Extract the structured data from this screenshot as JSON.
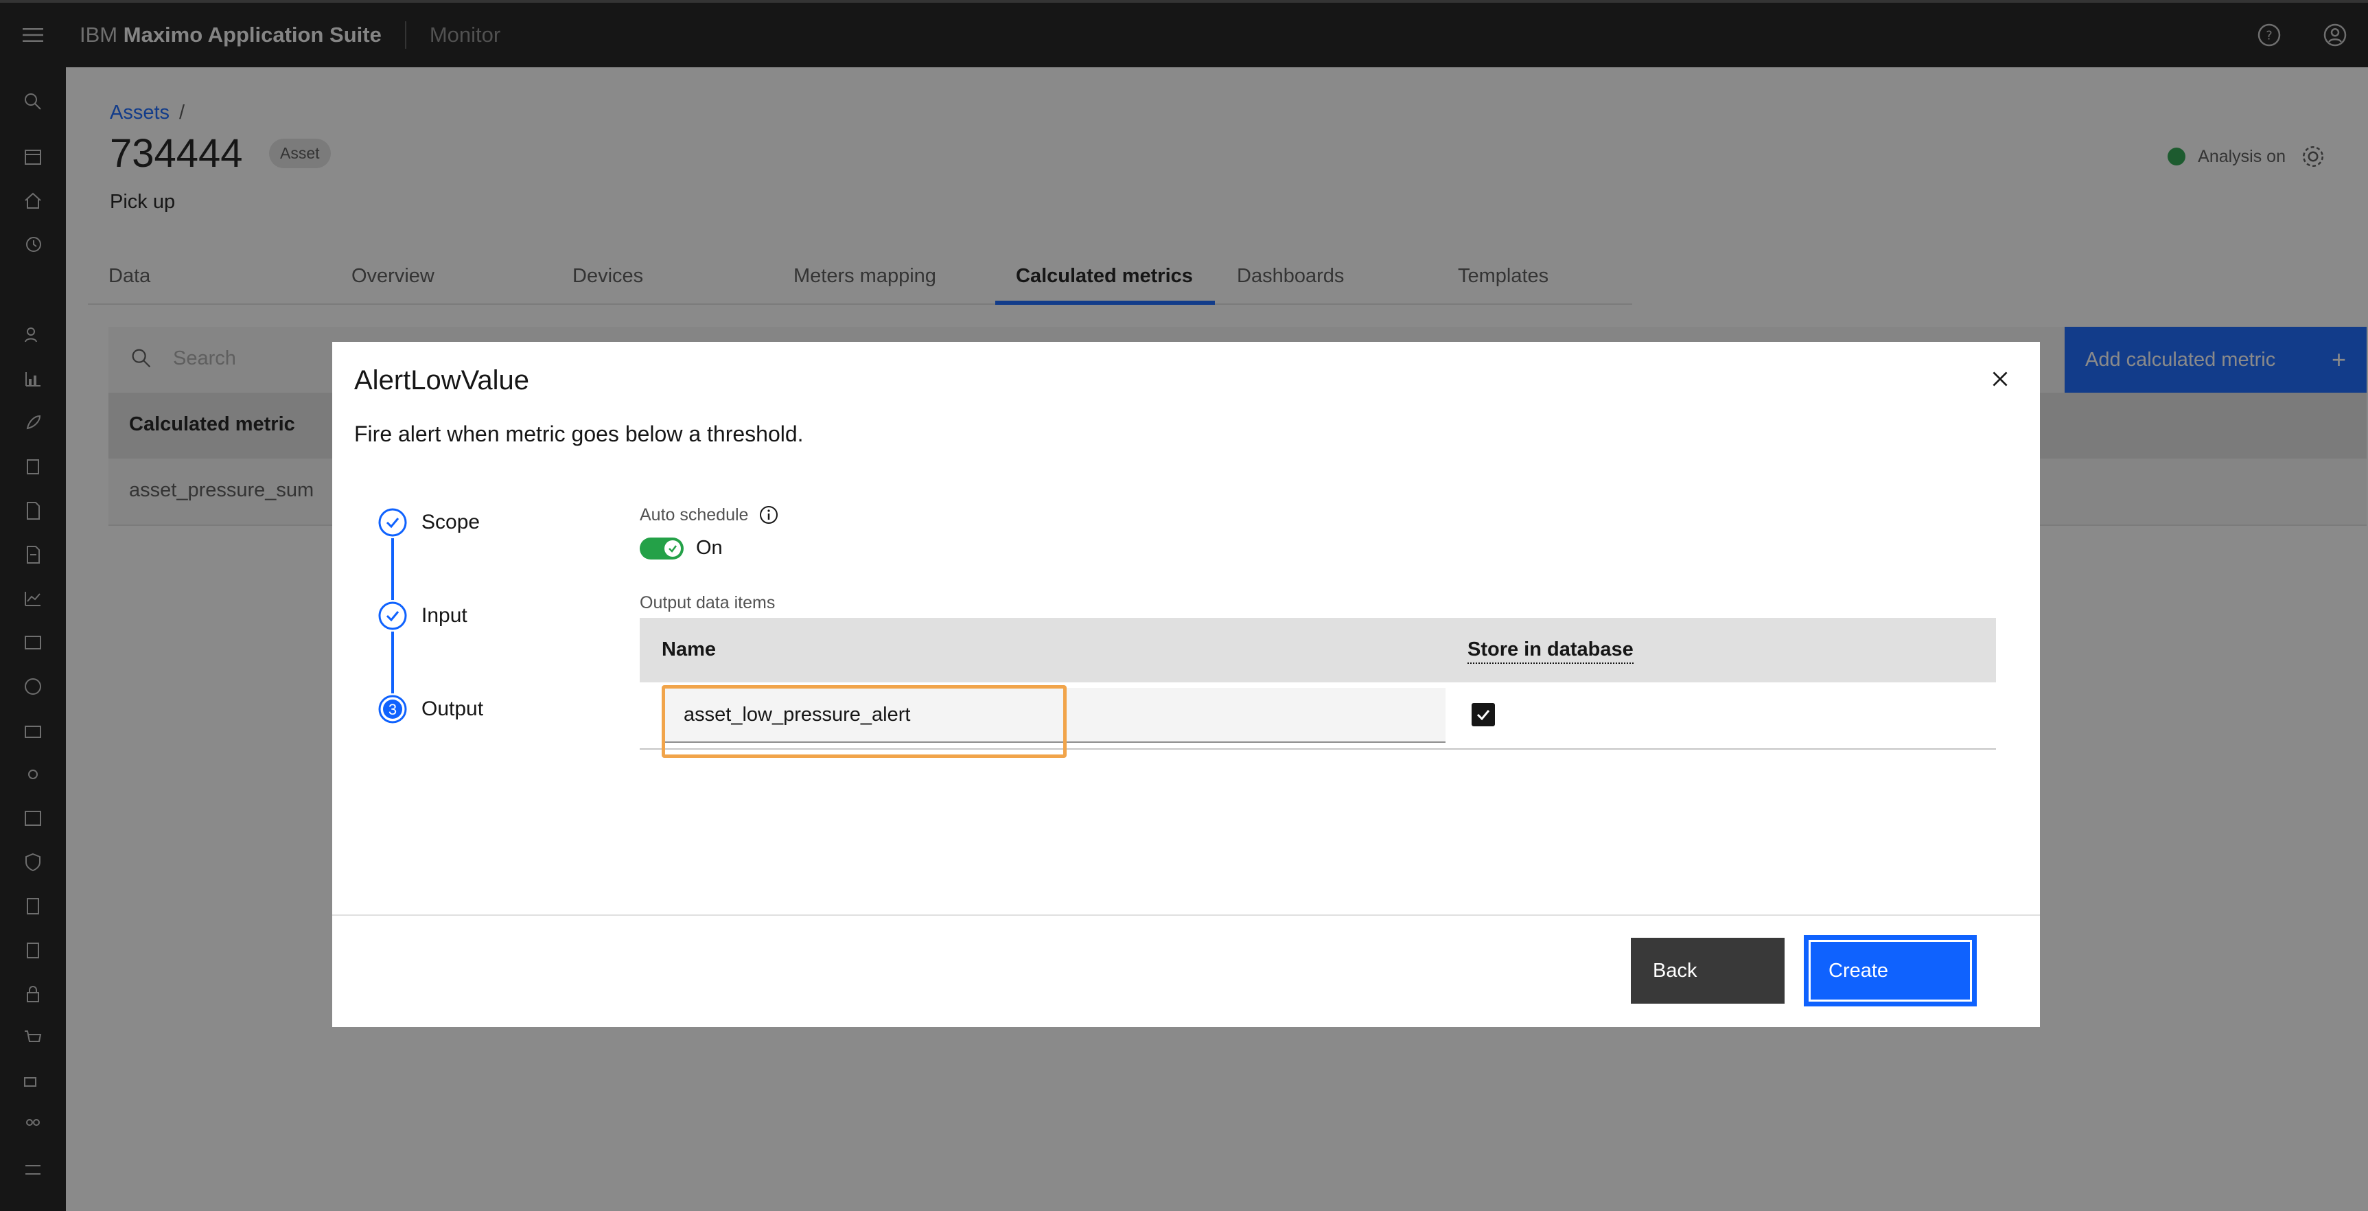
{
  "header": {
    "brand_prefix": "IBM",
    "brand_name": "Maximo Application Suite",
    "product": "Monitor"
  },
  "page": {
    "breadcrumb": "Assets",
    "breadcrumb_sep": "/",
    "asset_id": "734444",
    "asset_tag": "Asset",
    "asset_description": "Pick up",
    "analysis_status": "Analysis on"
  },
  "tabs": [
    {
      "label": "Data"
    },
    {
      "label": "Overview"
    },
    {
      "label": "Devices"
    },
    {
      "label": "Meters mapping"
    },
    {
      "label": "Calculated metrics"
    },
    {
      "label": "Dashboards"
    },
    {
      "label": "Templates"
    }
  ],
  "active_tab": "Calculated metrics",
  "list": {
    "search_placeholder": "Search",
    "add_button": "Add calculated metric",
    "column_header": "Calculated metric",
    "rows": [
      "asset_pressure_sum"
    ]
  },
  "modal": {
    "title": "AlertLowValue",
    "subtitle": "Fire alert when metric goes below a threshold.",
    "steps": [
      {
        "label": "Scope",
        "state": "complete"
      },
      {
        "label": "Input",
        "state": "complete"
      },
      {
        "label": "Output",
        "state": "current",
        "number": "3"
      }
    ],
    "auto_schedule_label": "Auto schedule",
    "auto_schedule_state": "On",
    "output_label": "Output data items",
    "table": {
      "col_name": "Name",
      "col_store": "Store in database",
      "rows": [
        {
          "name": "asset_low_pressure_alert",
          "store": true
        }
      ]
    },
    "back_button": "Back",
    "create_button": "Create"
  },
  "colors": {
    "primary": "#0f62fe",
    "success": "#24a148",
    "highlight": "#f1a44a",
    "header_bg": "#161616"
  }
}
